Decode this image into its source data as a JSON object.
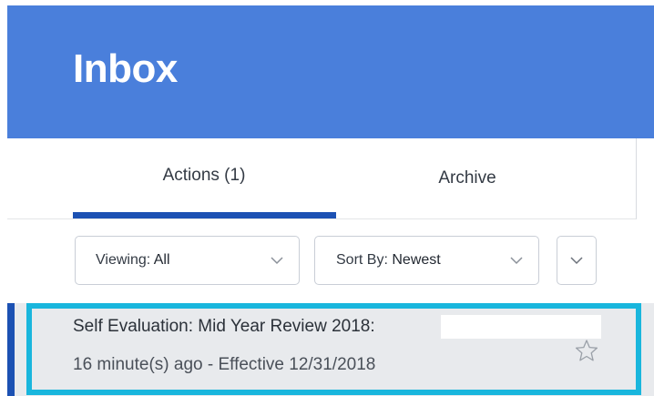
{
  "header": {
    "title": "Inbox"
  },
  "tabs": [
    {
      "label": "Actions (1)",
      "active": true
    },
    {
      "label": "Archive",
      "active": false
    }
  ],
  "filters": {
    "viewing": {
      "prefix": "Viewing:",
      "value": "All"
    },
    "sort": {
      "prefix": "Sort By:",
      "value": "Newest"
    }
  },
  "inbox_items": [
    {
      "title": "Self Evaluation: Mid Year Review 2018:",
      "meta": "16 minute(s) ago - Effective 12/31/2018",
      "starred": false
    }
  ],
  "colors": {
    "header_bg": "#4a7fdb",
    "accent": "#1c51b3",
    "selection_highlight": "#19b6dd",
    "item_bg": "#e8eaed"
  },
  "icons": {
    "dropdown": "chevron-down-icon",
    "favorite": "star-icon"
  }
}
